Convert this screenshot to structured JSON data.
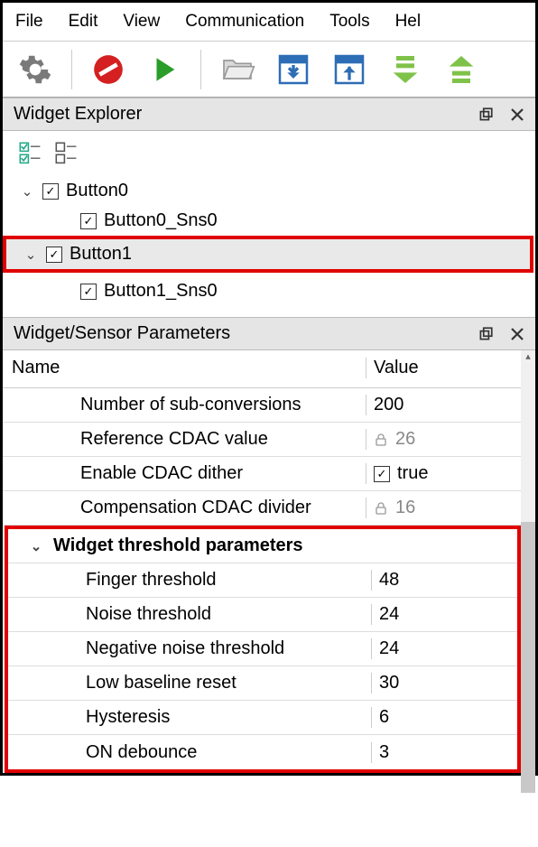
{
  "menu": {
    "items": [
      "File",
      "Edit",
      "View",
      "Communication",
      "Tools",
      "Hel"
    ]
  },
  "toolbar": {
    "icons": [
      "settings",
      "forbidden",
      "play",
      "open",
      "download-box",
      "upload-box",
      "stack-down",
      "stack-up"
    ]
  },
  "explorer": {
    "title": "Widget Explorer",
    "tree": [
      {
        "label": "Button0",
        "checked": true,
        "expanded": true,
        "children": [
          {
            "label": "Button0_Sns0",
            "checked": true
          }
        ]
      },
      {
        "label": "Button1",
        "checked": true,
        "expanded": true,
        "selected": true,
        "children": [
          {
            "label": "Button1_Sns0",
            "checked": true
          }
        ]
      }
    ]
  },
  "params": {
    "title": "Widget/Sensor Parameters",
    "header_name": "Name",
    "header_value": "Value",
    "rows_top": [
      {
        "name": "Number of sub-conversions",
        "value": "200",
        "locked": false
      },
      {
        "name": "Reference CDAC value",
        "value": "26",
        "locked": true
      },
      {
        "name": "Enable CDAC dither",
        "value": "true",
        "locked": false,
        "checkbox": true
      },
      {
        "name": "Compensation CDAC divider",
        "value": "16",
        "locked": true
      }
    ],
    "group_label": "Widget threshold parameters",
    "rows_group": [
      {
        "name": "Finger threshold",
        "value": "48"
      },
      {
        "name": "Noise threshold",
        "value": "24"
      },
      {
        "name": "Negative noise threshold",
        "value": "24"
      },
      {
        "name": "Low baseline reset",
        "value": "30"
      },
      {
        "name": "Hysteresis",
        "value": "6"
      },
      {
        "name": "ON debounce",
        "value": "3"
      }
    ]
  }
}
